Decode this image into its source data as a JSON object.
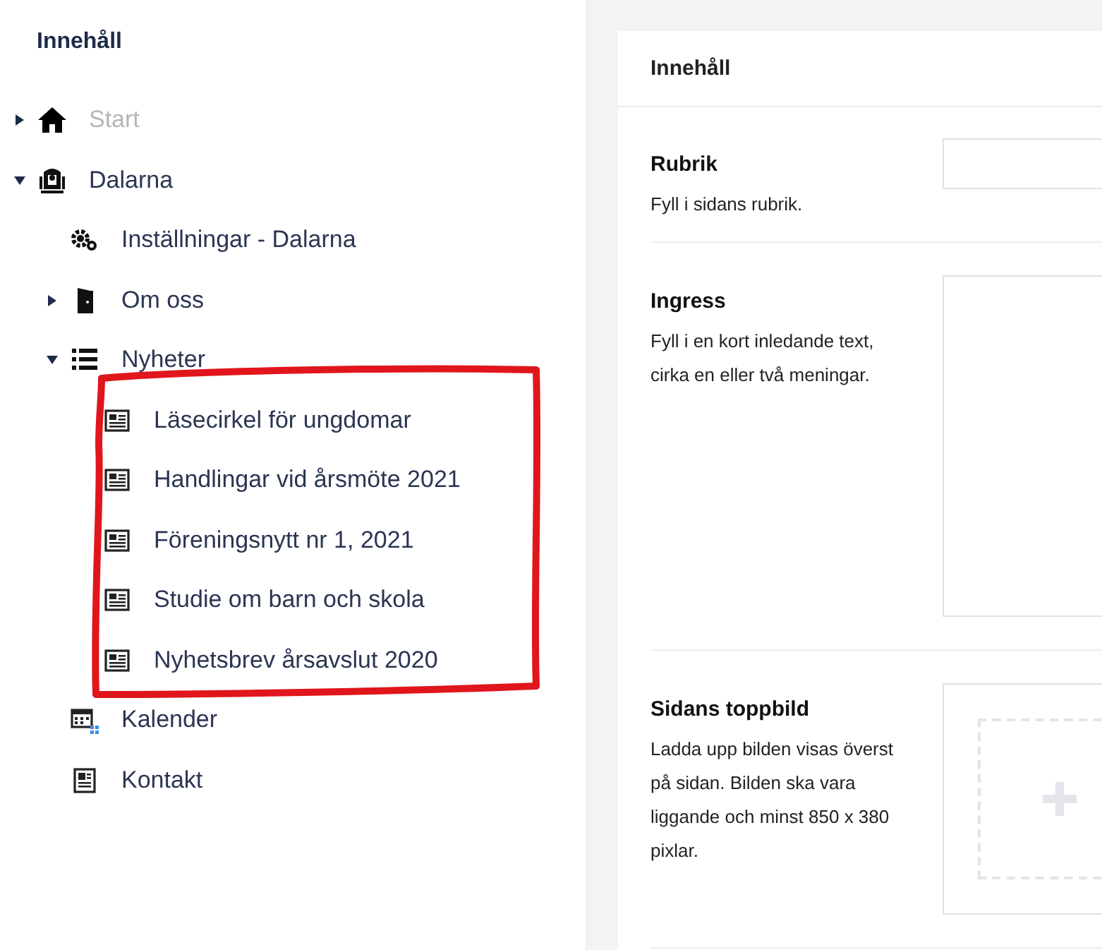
{
  "sidebar": {
    "title": "Innehåll",
    "tree": [
      {
        "label": "Start",
        "kind": "home",
        "disabled": true,
        "expanded": false
      },
      {
        "label": "Dalarna",
        "kind": "building",
        "disabled": false,
        "expanded": true,
        "children": [
          {
            "label": "Inställningar - Dalarna",
            "kind": "gears",
            "disabled": false
          },
          {
            "label": "Om oss",
            "kind": "door",
            "disabled": false,
            "expanded": false
          },
          {
            "label": "Nyheter",
            "kind": "list",
            "disabled": false,
            "expanded": true,
            "children": [
              {
                "label": "Läsecirkel för ungdomar",
                "kind": "news",
                "disabled": false
              },
              {
                "label": "Handlingar vid årsmöte 2021",
                "kind": "news",
                "disabled": false
              },
              {
                "label": "Föreningsnytt nr 1, 2021",
                "kind": "news",
                "disabled": false
              },
              {
                "label": "Studie om barn och skola",
                "kind": "news",
                "disabled": false
              },
              {
                "label": "Nyhetsbrev årsavslut 2020",
                "kind": "news",
                "disabled": false
              }
            ]
          },
          {
            "label": "Kalender",
            "kind": "calendar",
            "disabled": false
          },
          {
            "label": "Kontakt",
            "kind": "contact",
            "disabled": false
          }
        ]
      }
    ]
  },
  "form": {
    "title": "Innehåll",
    "fields": [
      {
        "label": "Rubrik",
        "help": "Fyll i sidans rubrik.",
        "kind": "text"
      },
      {
        "label": "Ingress",
        "help": "Fyll i en kort inledande text, cirka en eller två meningar.",
        "kind": "textarea"
      },
      {
        "label": "Sidans toppbild",
        "help": "Ladda upp bilden visas överst på sidan. Bilden ska vara liggande och minst 850 x 380 pixlar.",
        "kind": "image"
      }
    ]
  }
}
